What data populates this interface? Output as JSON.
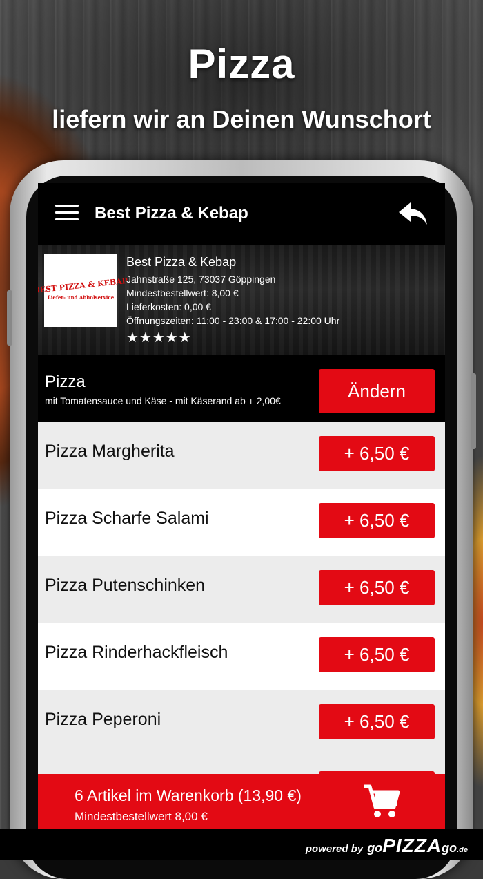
{
  "promo": {
    "title": "Pizza",
    "subtitle": "liefern wir an Deinen Wunschort"
  },
  "appbar": {
    "title": "Best Pizza & Kebap",
    "menu_icon": "hamburger-menu-icon",
    "back_icon": "reply-back-icon"
  },
  "restaurant": {
    "logo_main": "BEST PIZZA & KEBAP",
    "logo_sub": "Liefer- und Abholservice",
    "name": "Best Pizza & Kebap",
    "address": "Jahnstraße 125, 73037 Göppingen",
    "min_order": "Mindestbestellwert: 8,00 €",
    "delivery_cost": "Lieferkosten: 0,00 €",
    "hours": "Öffnungszeiten: 11:00 - 23:00 & 17:00 - 22:00 Uhr",
    "rating_stars": "★★★★★",
    "rating_value": 5
  },
  "category": {
    "title": "Pizza",
    "description": "mit Tomatensauce und Käse - mit Käserand ab + 2,00€",
    "change_label": "Ändern"
  },
  "items": [
    {
      "name": "Pizza Margherita",
      "price": "+ 6,50 €"
    },
    {
      "name": "Pizza Scharfe Salami",
      "price": "+ 6,50 €"
    },
    {
      "name": "Pizza Putenschinken",
      "price": "+ 6,50 €"
    },
    {
      "name": "Pizza Rinderhackfleisch",
      "price": "+ 6,50 €"
    },
    {
      "name": "Pizza Peperoni",
      "price": "+ 6,50 €"
    }
  ],
  "cart": {
    "summary": "6 Artikel im Warenkorb (13,90 €)",
    "min_order": "Mindestbestellwert 8,00 €",
    "icon": "shopping-cart-icon"
  },
  "footer": {
    "powered_by": "powered by",
    "brand_go": "go",
    "brand_pizza": "PIZZA",
    "brand_go2": "go",
    "brand_tld": ".de"
  },
  "colors": {
    "accent_red": "#e30a14",
    "list_odd": "#ececec",
    "list_even": "#ffffff"
  }
}
